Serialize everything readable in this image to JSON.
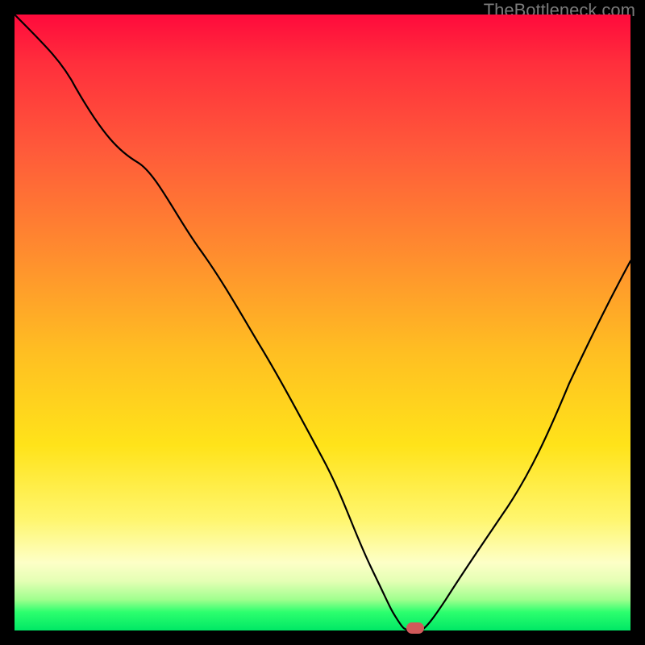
{
  "watermark": "TheBottleneck.com",
  "chart_data": {
    "type": "line",
    "title": "",
    "xlabel": "",
    "ylabel": "",
    "xlim": [
      0,
      100
    ],
    "ylim": [
      0,
      100
    ],
    "grid": false,
    "series": [
      {
        "name": "bottleneck-curve",
        "x": [
          0,
          10,
          20,
          30,
          40,
          50,
          58,
          62,
          64,
          66,
          70,
          80,
          90,
          100
        ],
        "y": [
          100,
          88,
          76,
          62,
          46,
          28,
          10,
          2,
          0,
          0,
          5,
          20,
          40,
          60
        ]
      }
    ],
    "annotations": [
      {
        "name": "optimal-marker",
        "x": 65,
        "y": 0
      }
    ],
    "background_gradient": [
      "#ff0a3c",
      "#ff8a2f",
      "#ffe31a",
      "#fdffc7",
      "#00e865"
    ]
  }
}
